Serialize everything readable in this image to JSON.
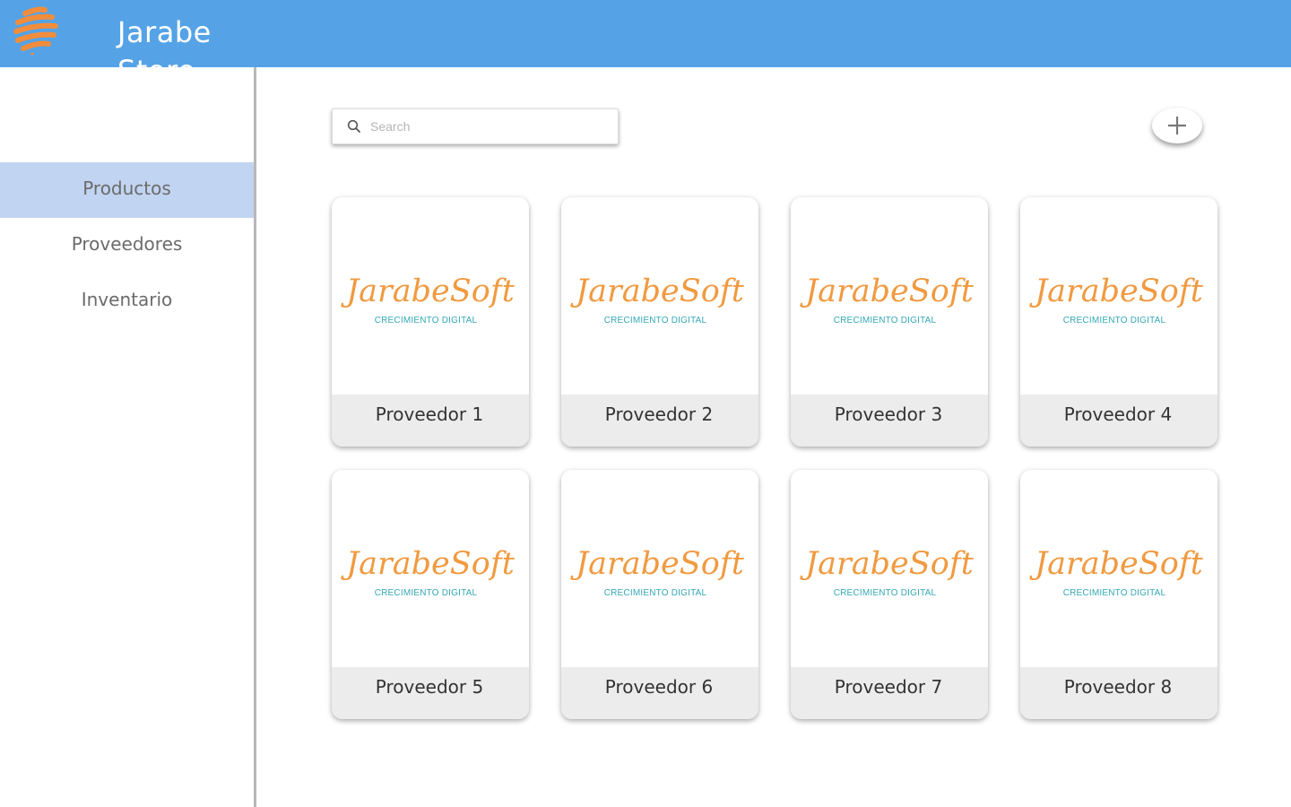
{
  "app": {
    "title": "Jarabe Store"
  },
  "sidebar": {
    "items": [
      {
        "label": "Productos",
        "active": true
      },
      {
        "label": "Proveedores",
        "active": false
      },
      {
        "label": "Inventario",
        "active": false
      }
    ]
  },
  "search": {
    "placeholder": "Search",
    "value": ""
  },
  "toolbar": {
    "add_icon": "plus-icon"
  },
  "logo": {
    "brand": "JarabeSoft",
    "tagline": "CRECIMIENTO DIGITAL"
  },
  "cards": [
    {
      "label": "Proveedor 1"
    },
    {
      "label": "Proveedor 2"
    },
    {
      "label": "Proveedor 3"
    },
    {
      "label": "Proveedor 4"
    },
    {
      "label": "Proveedor 5"
    },
    {
      "label": "Proveedor 6"
    },
    {
      "label": "Proveedor 7"
    },
    {
      "label": "Proveedor 8"
    }
  ],
  "colors": {
    "header": "#55a3e6",
    "active_nav": "#c1d4f1",
    "brand_orange": "#f09a40",
    "brand_teal": "#34a8b4"
  }
}
